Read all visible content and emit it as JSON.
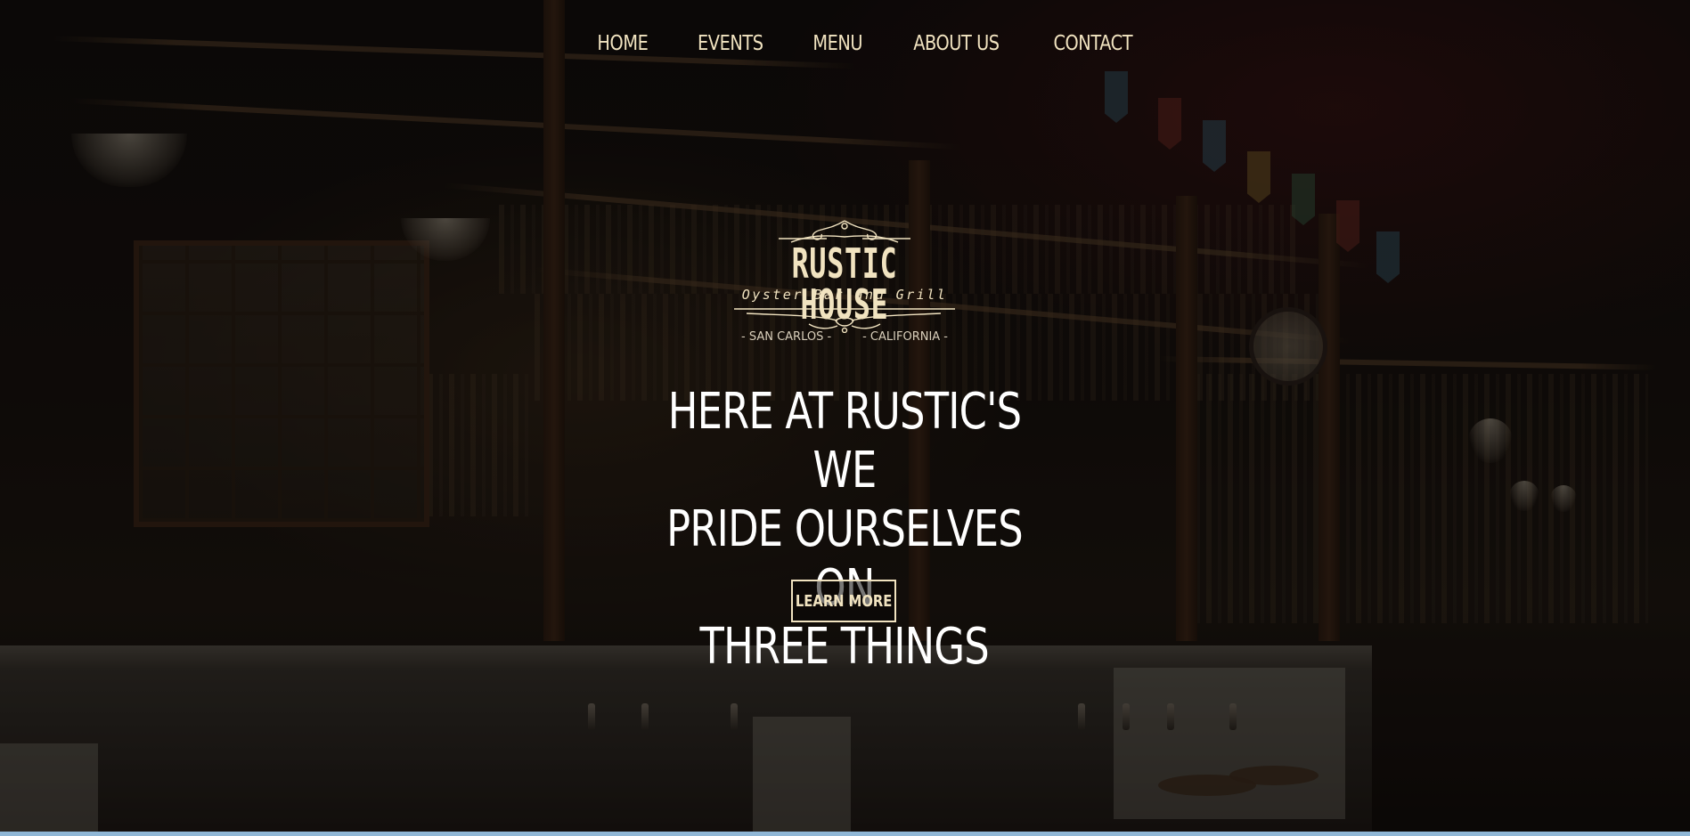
{
  "nav": {
    "items": [
      {
        "label": "HOME"
      },
      {
        "label": "EVENTS"
      },
      {
        "label": "MENU"
      },
      {
        "label": "ABOUT US"
      },
      {
        "label": "CONTACT"
      }
    ]
  },
  "logo": {
    "name": "RUSTIC HOUSE",
    "tagline": "Oyster Bar and Grill",
    "city": "- SAN CARLOS -",
    "state": "- CALIFORNIA -"
  },
  "hero": {
    "headline_lines": [
      "HERE AT RUSTIC'S WE",
      "PRIDE OURSELVES ON",
      "THREE THINGS"
    ],
    "cta_label": "LEARN MORE"
  },
  "colors": {
    "accent": "#f1e3c0",
    "headline": "#ffffff"
  }
}
